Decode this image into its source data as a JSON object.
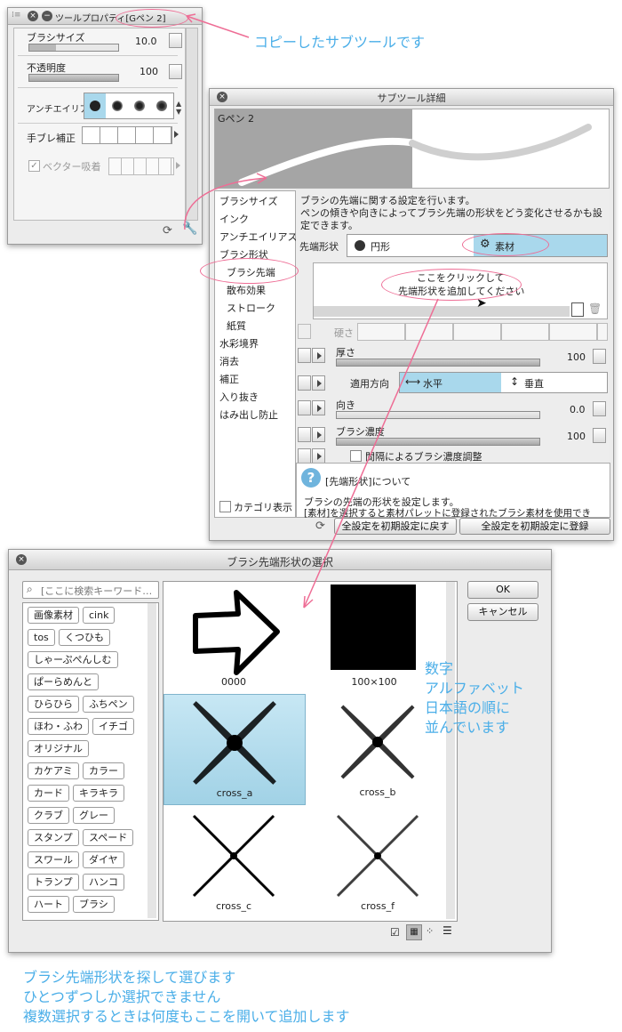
{
  "tool_property": {
    "title": "ツールプロパティ[Gペン 2]",
    "brush_size_label": "ブラシサイズ",
    "brush_size_value": "10.0",
    "opacity_label": "不透明度",
    "opacity_value": "100",
    "antialias_label": "アンチエイリア",
    "stabilization_label": "手ブレ補正",
    "vector_snap_label": "ベクター吸着"
  },
  "subtool_detail": {
    "title": "サブツール詳細",
    "preview_name": "Gペン 2",
    "categories": [
      "ブラシサイズ",
      "インク",
      "アンチエイリアス",
      "ブラシ形状",
      "ブラシ先端",
      "散布効果",
      "ストローク",
      "紙質",
      "水彩境界",
      "消去",
      "補正",
      "入り抜き",
      "はみ出し防止"
    ],
    "category_display_label": "カテゴリ表示",
    "description_line1": "ブラシの先端に関する設定を行います。",
    "description_line2": "ペンの傾きや向きによってブラシ先端の形状をどう変化させるかも設",
    "description_line3": "定できます。",
    "tip_shape_label": "先端形状",
    "shape_circle": "円形",
    "shape_material": "素材",
    "add_line1": "ここをクリックして",
    "add_line2": "先端形状を追加してください",
    "hardness_label": "硬さ",
    "thickness_label": "厚さ",
    "thickness_value": "100",
    "direction_apply_label": "適用方向",
    "horizontal_label": "水平",
    "vertical_label": "垂直",
    "angle_label": "向き",
    "angle_value": "0.0",
    "density_label": "ブラシ濃度",
    "density_value": "100",
    "interval_density_label": "間隔によるブラシ濃度調整",
    "help_title": "[先端形状]について",
    "help_line1": "ブラシの先端の形状を設定します。",
    "help_line2": "[素材]を選択すると素材パレットに登録されたブラシ素材を使用でき",
    "reset_button": "全設定を初期設定に戻す",
    "register_button": "全設定を初期設定に登録"
  },
  "tip_select": {
    "title": "ブラシ先端形状の選択",
    "search_placeholder": "[ここに検索キーワード…",
    "tags": [
      [
        "画像素材",
        "cink"
      ],
      [
        "tos",
        "くつひも"
      ],
      [
        "しゃーぷぺんしむ"
      ],
      [
        "ぱーらめんと"
      ],
      [
        "ひらひら",
        "ふちペン"
      ],
      [
        "ほわ・ふわ",
        "イチゴ"
      ],
      [
        "オリジナル"
      ],
      [
        "カケアミ",
        "カラー"
      ],
      [
        "カード",
        "キラキラ"
      ],
      [
        "クラブ",
        "グレー"
      ],
      [
        "スタンプ",
        "スペード"
      ],
      [
        "スワール",
        "ダイヤ"
      ],
      [
        "トランプ",
        "ハンコ"
      ],
      [
        "ハート",
        "ブラシ"
      ]
    ],
    "thumbnails": [
      "0000",
      "100×100",
      "cross_a",
      "cross_b",
      "cross_c",
      "cross_f"
    ],
    "selected_index": 2,
    "ok_button": "OK",
    "cancel_button": "キャンセル"
  },
  "annotations": {
    "copied_subtool": "コピーしたサブツールです",
    "sort_line1": "数字",
    "sort_line2": "アルファベット",
    "sort_line3": "日本語の順に",
    "sort_line4": "並んでいます",
    "bottom_line1": "ブラシ先端形状を探して選びます",
    "bottom_line2": "ひとつずつしか選択できません",
    "bottom_line3": "複数選択するときは何度もここを開いて追加します"
  },
  "colors": {
    "annotation_pink": "#ee6d95",
    "annotation_blue": "#4aaee8",
    "selection_blue": "#a9d8ec"
  }
}
